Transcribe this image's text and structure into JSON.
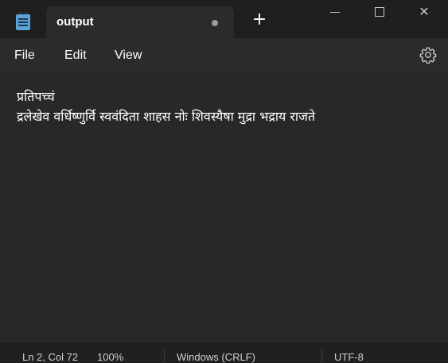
{
  "window": {
    "tab_title": "output",
    "new_tab_glyph": "+",
    "close_glyph": "✕"
  },
  "menu": {
    "file": "File",
    "edit": "Edit",
    "view": "View"
  },
  "editor": {
    "lines": [
      "प्रतिपच्चं",
      "द्रलेखेव वर्धिष्णुर्वि स्ववंदिता शाहस नोः शिवस्यैषा मुद्रा भद्राय राजते"
    ]
  },
  "status": {
    "position": "Ln 2, Col 72",
    "zoom": "100%",
    "line_endings": "Windows (CRLF)",
    "encoding": "UTF-8"
  },
  "icons": {
    "app": "notepad-icon",
    "settings": "gear-icon",
    "unsaved": "unsaved-dot-icon"
  },
  "colors": {
    "titlebar": "#1f1f1f",
    "background": "#2b2b2b",
    "editor": "#282828",
    "statusbar": "#202020",
    "text": "#ffffff"
  }
}
